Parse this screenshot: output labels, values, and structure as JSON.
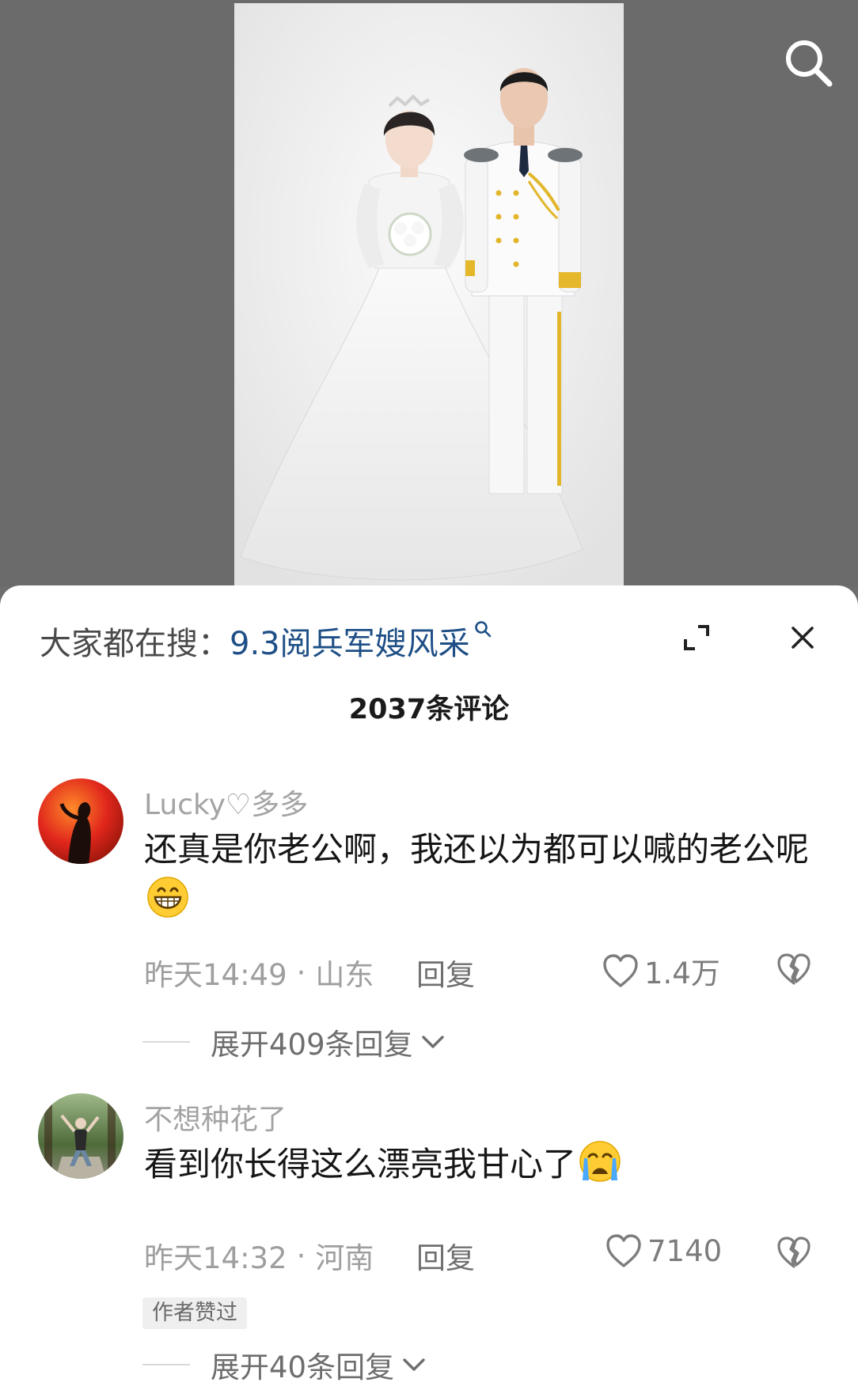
{
  "hot_search": {
    "prefix": "大家都在搜：",
    "term": "9.3阅兵军嫂风采"
  },
  "comments_header": {
    "count_label": "2037条评论"
  },
  "comments": [
    {
      "username": "Lucky♡多多",
      "text": "还真是你老公啊，我还以为都可以喊的老公呢",
      "emoji": "grinning-face-emoji",
      "time": "昨天14:49",
      "location": "山东",
      "reply_label": "回复",
      "likes": "1.4万",
      "expand_label": "展开409条回复"
    },
    {
      "username": "不想种花了",
      "text": "看到你长得这么漂亮我甘心了",
      "emoji": "crying-face-emoji",
      "time": "昨天14:32",
      "location": "河南",
      "reply_label": "回复",
      "likes": "7140",
      "badge": "作者赞过",
      "expand_label": "展开40条回复"
    }
  ],
  "colors": {
    "link_blue": "#1e4f86",
    "muted_text": "#9e9e9e",
    "backdrop": "#6b6b6b"
  },
  "icons": [
    "search-icon",
    "expand-icon",
    "close-icon",
    "heart-icon",
    "broken-heart-icon",
    "chevron-down-icon"
  ]
}
